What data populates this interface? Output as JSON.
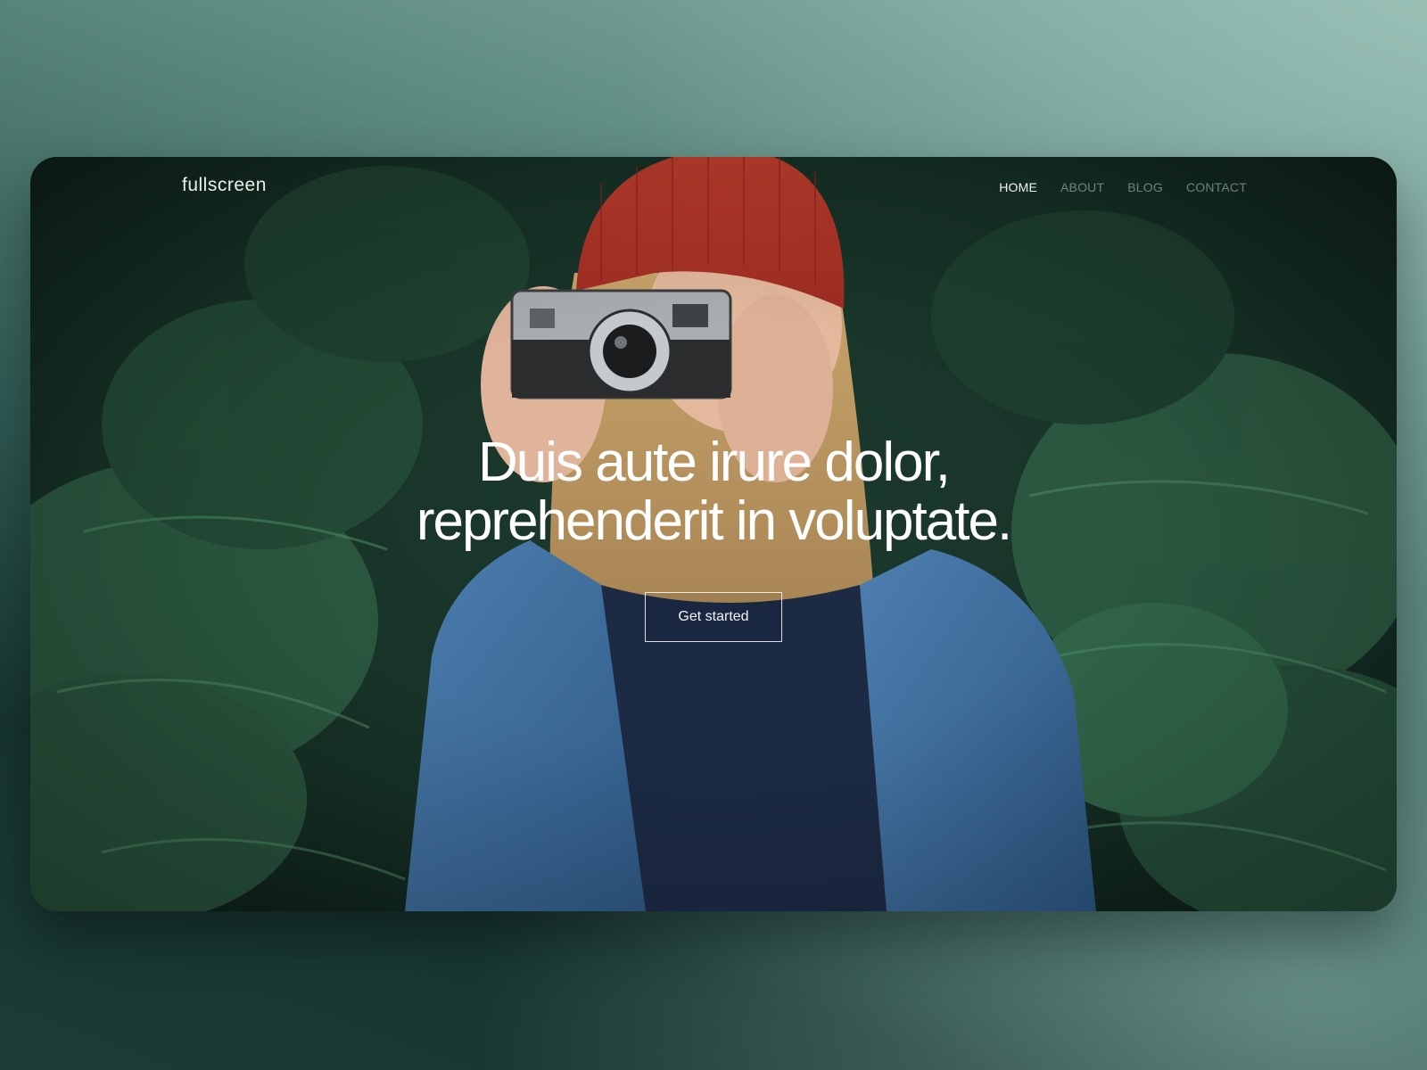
{
  "brand": {
    "name": "fullscreen"
  },
  "nav": {
    "items": [
      {
        "label": "HOME",
        "active": true
      },
      {
        "label": "ABOUT",
        "active": false
      },
      {
        "label": "BLOG",
        "active": false
      },
      {
        "label": "CONTACT",
        "active": false
      }
    ]
  },
  "hero": {
    "headline_line1": "Duis aute irure dolor,",
    "headline_line2": "reprehenderit in voluptate.",
    "cta_label": "Get started",
    "image_subject": "woman-with-red-beanie-holding-camera-icon"
  },
  "colors": {
    "beanie": "#b8352a",
    "denim": "#3f6d9c",
    "foliage": "#2d5a3f",
    "backdrop": "#2f5a53"
  }
}
